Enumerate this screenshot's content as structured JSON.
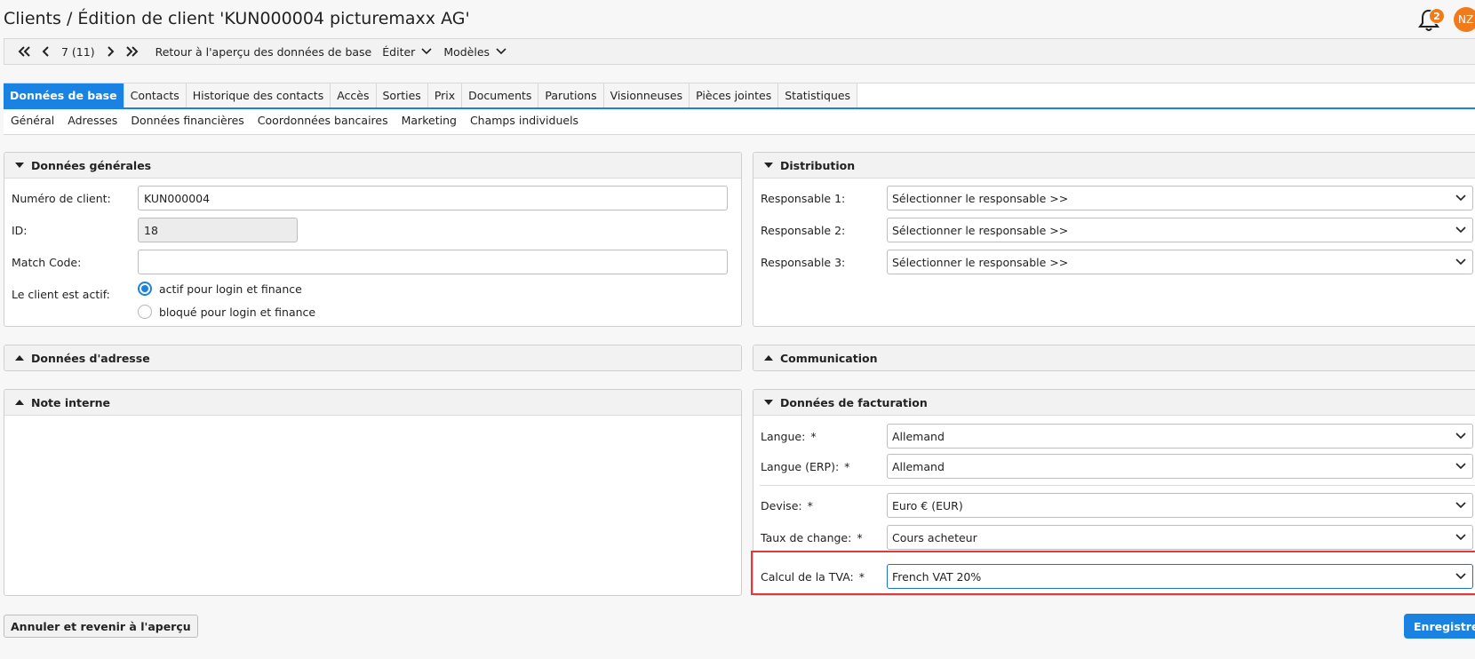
{
  "header": {
    "title": "Clients / Édition de client 'KUN000004 picturemaxx AG'",
    "notification_count": "2",
    "avatar_initials": "NZ"
  },
  "toolbar": {
    "position": "7 (11)",
    "back_label": "Retour à l'aperçu des données de base",
    "edit_label": "Éditer",
    "templates_label": "Modèles"
  },
  "tabs": [
    {
      "label": "Données de base",
      "active": true
    },
    {
      "label": "Contacts"
    },
    {
      "label": "Historique des contacts"
    },
    {
      "label": "Accès"
    },
    {
      "label": "Sorties"
    },
    {
      "label": "Prix"
    },
    {
      "label": "Documents"
    },
    {
      "label": "Parutions"
    },
    {
      "label": "Visionneuses"
    },
    {
      "label": "Pièces jointes"
    },
    {
      "label": "Statistiques"
    }
  ],
  "subtabs": [
    "Général",
    "Adresses",
    "Données financières",
    "Coordonnées bancaires",
    "Marketing",
    "Champs individuels"
  ],
  "general": {
    "title": "Données générales",
    "client_number_label": "Numéro de client:",
    "client_number_value": "KUN000004",
    "id_label": "ID:",
    "id_value": "18",
    "match_code_label": "Match Code:",
    "match_code_value": "",
    "active_label": "Le client est actif:",
    "option_active": "actif pour login et finance",
    "option_blocked": "bloqué pour login et finance"
  },
  "distribution": {
    "title": "Distribution",
    "resp1_label": "Responsable 1:",
    "resp2_label": "Responsable 2:",
    "resp3_label": "Responsable 3:",
    "resp_placeholder": "Sélectionner le responsable >>"
  },
  "address": {
    "title": "Données d'adresse"
  },
  "communication": {
    "title": "Communication"
  },
  "note": {
    "title": "Note interne"
  },
  "billing": {
    "title": "Données de facturation",
    "language_label": "Langue:",
    "language_value": "Allemand",
    "language_erp_label": "Langue (ERP):",
    "language_erp_value": "Allemand",
    "currency_label": "Devise:",
    "currency_value": "Euro € (EUR)",
    "exchange_label": "Taux de change:",
    "exchange_value": "Cours acheteur",
    "vat_label": "Calcul de la TVA:",
    "vat_value": "French VAT 20%",
    "required_mark": "*"
  },
  "footer": {
    "cancel_label": "Annuler et revenir à l'aperçu",
    "save_label": "Enregistrer"
  },
  "colors": {
    "accent": "#1a82e2",
    "badge": "#f07b1a",
    "highlight": "#e0393e"
  }
}
